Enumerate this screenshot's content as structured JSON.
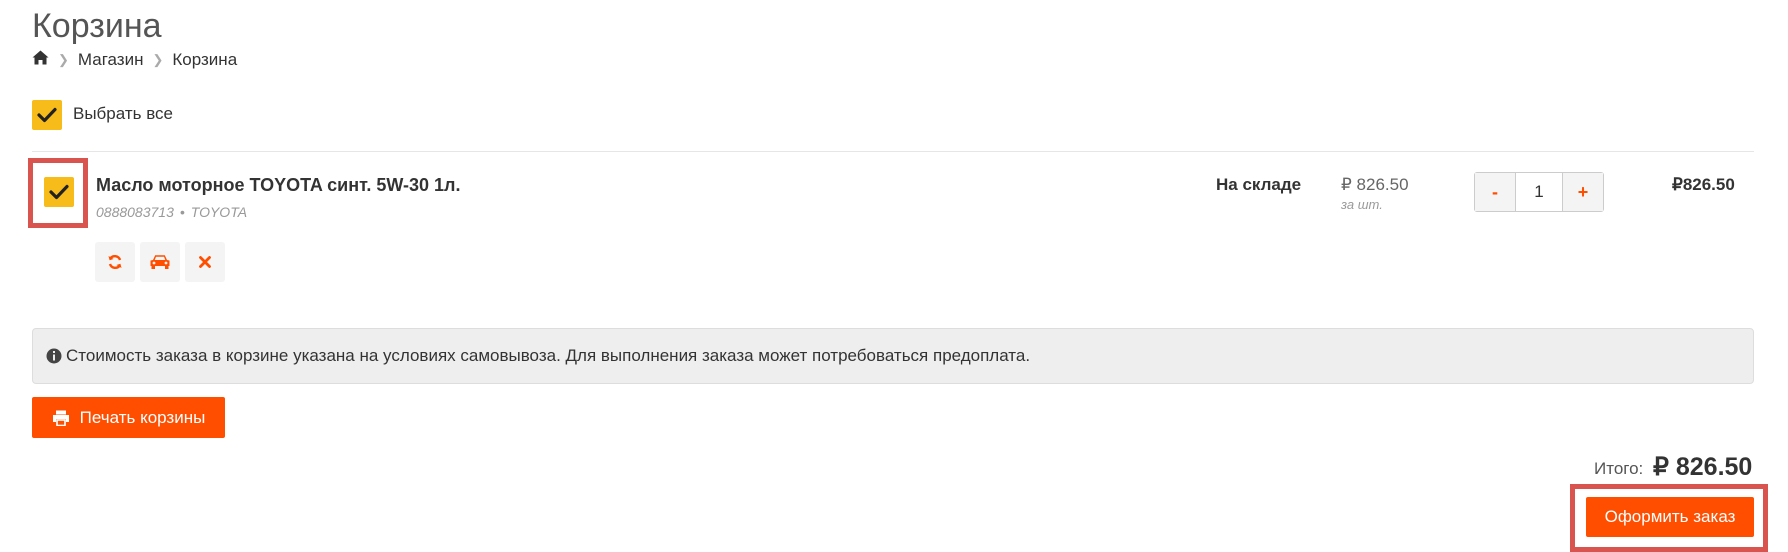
{
  "page": {
    "title": "Корзина"
  },
  "breadcrumb": {
    "home_icon": "home-icon",
    "separator_icon": "chevron-right-icon",
    "items": [
      "Магазин",
      "Корзина"
    ]
  },
  "select_all": {
    "label": "Выбрать все",
    "checked": true,
    "icon": "checkmark-icon"
  },
  "cart": {
    "items": [
      {
        "name": "Масло моторное TOYOTA синт. 5W-30 1л.",
        "article": "0888083713",
        "meta_separator": "•",
        "brand": "TOYOTA",
        "checked": true,
        "availability": "На складе",
        "price": "₽ 826.50",
        "price_unit": "за шт.",
        "quantity": "1",
        "qty_minus": "-",
        "qty_plus": "+",
        "total": "₽826.50",
        "actions": [
          "refresh-icon",
          "car-icon",
          "close-icon"
        ]
      }
    ]
  },
  "notice": {
    "icon": "info-circle-icon",
    "text": "Стоимость заказа в корзине указана на условиях самовывоза. Для выполнения заказа может потребоваться предоплата."
  },
  "print_button": {
    "label": "Печать корзины",
    "icon": "print-icon"
  },
  "summary": {
    "total_label": "Итого:",
    "total_value": "₽ 826.50"
  },
  "checkout_button": {
    "label": "Оформить заказ"
  },
  "colors": {
    "accent": "#ff4e00",
    "checkbox": "#f7bb1a",
    "highlight": "#d9534f",
    "notice_bg": "#eeeeee"
  }
}
